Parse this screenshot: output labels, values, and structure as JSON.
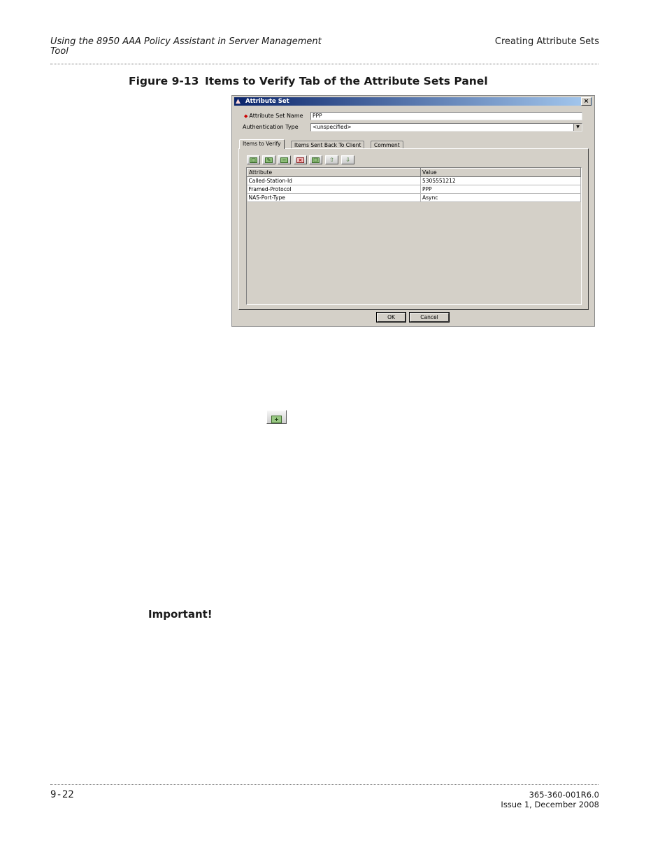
{
  "header": {
    "left_title": "Using the 8950 AAA Policy Assistant in Server Management Tool",
    "right_title": "Creating Attribute Sets"
  },
  "figure": {
    "number": "Figure 9-13",
    "caption": "Items to Verify Tab of the Attribute Sets Panel"
  },
  "dialog": {
    "title": "Attribute Set",
    "attribute_set_name_label": "Attribute Set Name",
    "attribute_set_name_value": "PPP",
    "authentication_type_label": "Authentication Type",
    "authentication_type_value": "<unspecified>",
    "tabs": [
      "Items to Verify",
      "Items Sent Back To Client",
      "Comment"
    ],
    "active_tab": "Items to Verify",
    "toolbar_icons": [
      "add-icon",
      "edit-icon",
      "remove-icon",
      "delete-icon",
      "copy-icon",
      "move-up-icon",
      "move-down-icon"
    ],
    "table": {
      "columns": [
        "Attribute",
        "Value"
      ],
      "rows": [
        [
          "Called-Station-Id",
          "5305551212"
        ],
        [
          "Framed-Protocol",
          "PPP"
        ],
        [
          "NAS-Port-Type",
          "Async"
        ]
      ]
    },
    "ok_label": "OK",
    "cancel_label": "Cancel"
  },
  "body": {
    "important_label": "Important!"
  },
  "footer": {
    "page_number": "9-22",
    "doc_number": "365-360-001R6.0",
    "issue": "Issue 1, December 2008"
  }
}
